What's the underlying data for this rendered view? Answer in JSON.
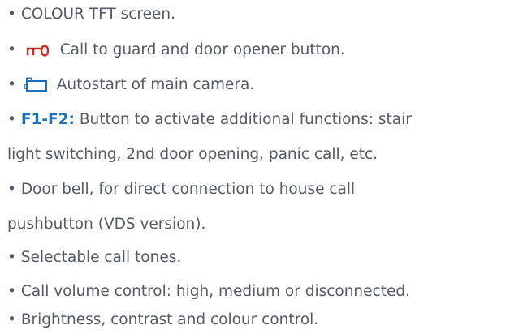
{
  "features": {
    "items": [
      {
        "bullet": "•",
        "text": "COLOUR TFT screen."
      },
      {
        "bullet": "•",
        "icon": "key-icon",
        "text": "Call to guard and door opener button."
      },
      {
        "bullet": "•",
        "icon": "camera-icon",
        "text": "Autostart of main camera."
      },
      {
        "bullet": "•",
        "highlight": "F1-F2:",
        "text_line1": "Button to activate additional functions: stair",
        "text_line2": "light switching, 2nd door opening, panic call, etc."
      },
      {
        "bullet": "•",
        "text_line1": "Door bell, for direct connection to house call",
        "text_line2": "pushbutton (VDS version)."
      },
      {
        "bullet": "•",
        "text": "Selectable call tones."
      },
      {
        "bullet": "•",
        "text": "Call volume control: high, medium or disconnected."
      },
      {
        "bullet": "•",
        "text": "Brightness, contrast and colour control."
      }
    ]
  },
  "colors": {
    "text": "#555a66",
    "accent": "#1c6fbf"
  }
}
